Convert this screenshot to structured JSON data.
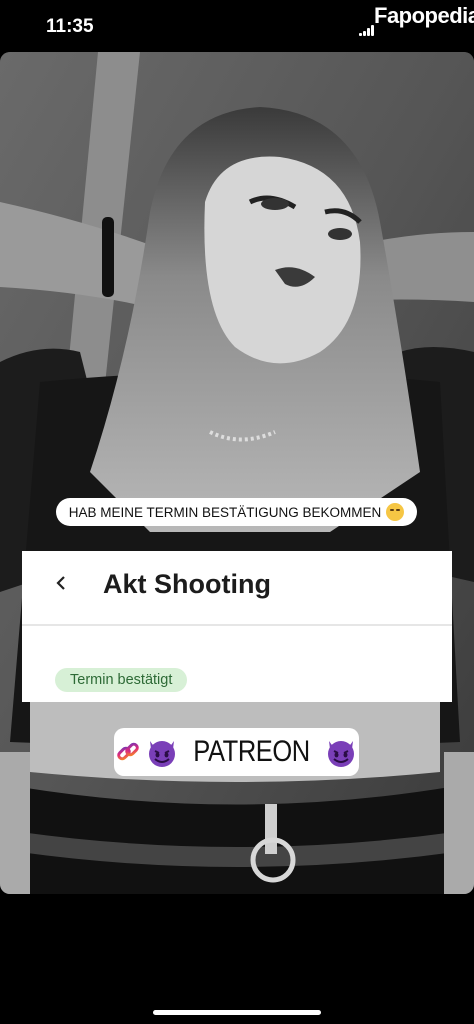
{
  "status_bar": {
    "time": "11:35",
    "watermark": "Fapopedia"
  },
  "story": {
    "caption": "HAB MEINE TERMIN BESTÄTIGUNG BEKOMMEN",
    "card": {
      "title": "Akt Shooting",
      "status": "Termin bestätigt"
    },
    "link_sticker": {
      "label": "PATREON"
    }
  },
  "icons": {
    "back": "chevron-left-icon",
    "link": "link-icon",
    "emoji": "devil-emoji-icon",
    "caption_emoji": "blushing-emoji-icon"
  },
  "colors": {
    "badge_bg": "#d7f0d6",
    "badge_text": "#2d6a36",
    "devil": "#7a3fb8"
  }
}
